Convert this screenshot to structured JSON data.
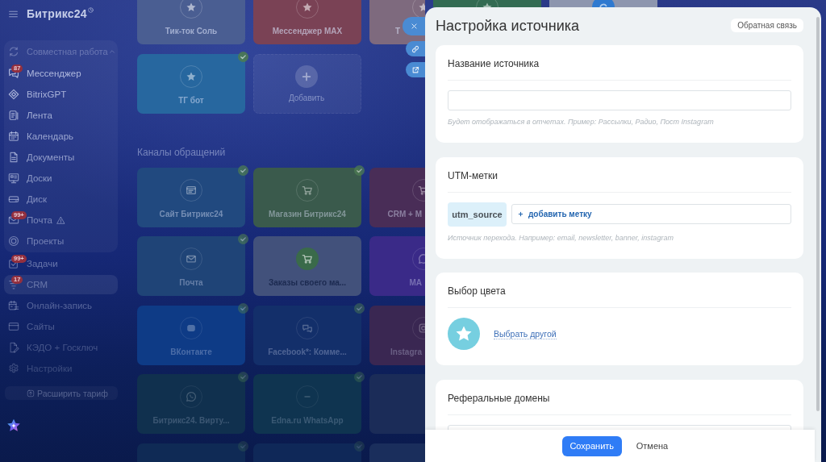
{
  "sidebar": {
    "logo": "Битрикс24",
    "group": {
      "label": "Совместная работа",
      "expanded": true,
      "items": [
        {
          "label": "Мессенджер",
          "badge": "87",
          "warning": false,
          "selected": false
        },
        {
          "label": "BitrixGPT",
          "warning": false,
          "selected": false
        },
        {
          "label": "Лента",
          "warning": false,
          "selected": false
        },
        {
          "label": "Календарь",
          "warning": false,
          "selected": false
        },
        {
          "label": "Документы",
          "warning": false,
          "selected": false
        },
        {
          "label": "Доски",
          "warning": false,
          "selected": false
        },
        {
          "label": "Диск",
          "warning": false,
          "selected": false
        },
        {
          "label": "Почта",
          "badge": "99+",
          "warning": true,
          "selected": false
        },
        {
          "label": "Проекты",
          "warning": false,
          "selected": false
        }
      ]
    },
    "items": [
      {
        "label": "Задачи",
        "badge": "99+",
        "warning": false,
        "selected": false
      },
      {
        "label": "CRM",
        "badge": "17",
        "warning": false,
        "selected": true
      },
      {
        "label": "Онлайн-запись",
        "warning": false,
        "selected": false
      },
      {
        "label": "Сайты",
        "warning": false,
        "selected": false
      },
      {
        "label": "КЭДО + Госключ",
        "warning": false,
        "selected": false
      },
      {
        "label": "Настройки",
        "warning": false,
        "selected": false
      }
    ],
    "upgrade_button": "Расширить тариф"
  },
  "board": {
    "sections": [
      {
        "rows": [
          [
            {
              "kind": "connected",
              "label": "Тик-ток Соль",
              "color": "#4a5e92"
            },
            {
              "kind": "connected",
              "label": "Мессенджер MAX",
              "color": "#7a4255"
            },
            {
              "kind": "connected",
              "label": "Т",
              "color": "#7e6a7e"
            },
            {
              "kind": "connected",
              "color": "#336b52"
            },
            {
              "kind": "available",
              "color": "#2f7ad0"
            }
          ],
          [
            {
              "kind": "connected",
              "label": "ТГ бот",
              "color": "#27679f",
              "checked": true
            },
            {
              "kind": "add",
              "label": "Добавить",
              "checked": false
            }
          ]
        ]
      },
      {
        "title": "Каналы обращений",
        "rows": [
          [
            {
              "kind": "connected",
              "label": "Сайт Битрикс24",
              "color": "#21497f",
              "checked": true
            },
            {
              "kind": "connected",
              "label": "Магазин Битрикс24",
              "color": "#3a5a4c",
              "checked": true
            },
            {
              "kind": "connected",
              "label": "CRM + М",
              "color": "#492d57"
            }
          ],
          [
            {
              "kind": "connected",
              "label": "Почта",
              "color": "#1f4477",
              "checked": true
            },
            {
              "kind": "available",
              "label": "Заказы своего ма...",
              "color": "#3a6a4a",
              "checked": false
            },
            {
              "kind": "connected",
              "label": "MA",
              "color": "#3a2a88"
            }
          ],
          [
            {
              "kind": "connected",
              "label": "ВКонтакте",
              "color": "#0e3b86",
              "checked": true
            },
            {
              "kind": "connected",
              "label": "Facebook*: Комме...",
              "color": "#132f6a",
              "checked": true
            },
            {
              "kind": "connected",
              "label": "Instagra",
              "color": "#3a2752"
            }
          ],
          [
            {
              "kind": "connected",
              "label": "Битрикс24. Вирту...",
              "color": "#10304e",
              "checked": true
            },
            {
              "kind": "connected",
              "label": "Edna.ru WhatsApp",
              "color": "#0f3450",
              "checked": true
            },
            {
              "kind": "connected",
              "color": "#1b2c58"
            }
          ],
          [
            {
              "kind": "connected",
              "color": "#0f2a55",
              "checked": true
            },
            {
              "kind": "connected",
              "color": "#0f2858",
              "checked": true
            },
            {
              "kind": "connected",
              "color": "#1a2e5c"
            }
          ]
        ]
      }
    ]
  },
  "panel": {
    "title": "Настройка источника",
    "feedback_button": "Обратная связь",
    "sections": [
      {
        "kind": "input",
        "title": "Название источника",
        "hint": "Будет отображаться в отчетах. Пример: Рассылки, Радио, Пост Instagram"
      },
      {
        "kind": "utm",
        "title": "UTM-метки",
        "tags": [
          "utm_source"
        ],
        "add_link": "добавить метку",
        "hint": "Источник перехода. Например: email, newsletter, banner, instagram"
      },
      {
        "kind": "color",
        "title": "Выбор цвета",
        "color": "#76cfe0",
        "link": "Выбрать другой"
      },
      {
        "kind": "input",
        "title": "Реферальные домены"
      }
    ],
    "footer": {
      "save_button": "Сохранить",
      "cancel_button": "Отмена"
    }
  }
}
